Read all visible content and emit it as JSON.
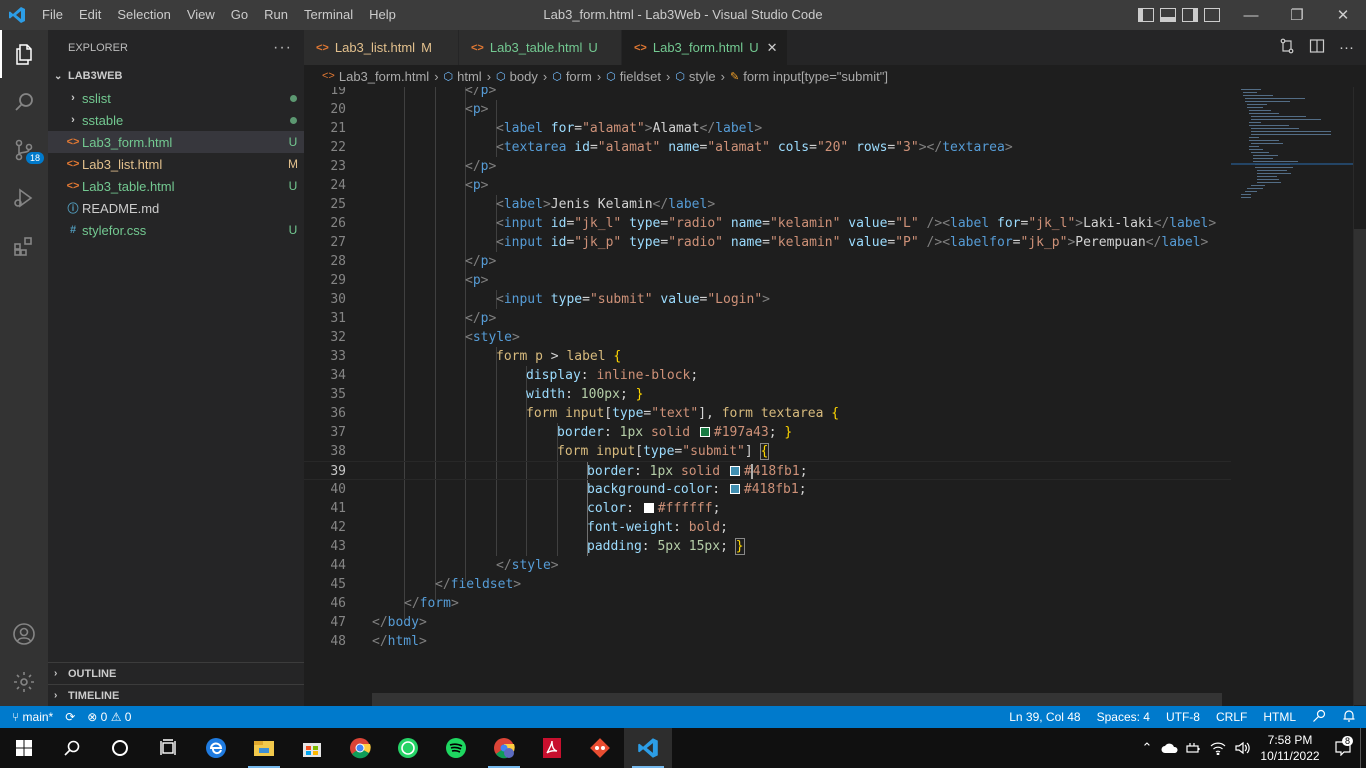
{
  "titlebar": {
    "menu": [
      "File",
      "Edit",
      "Selection",
      "View",
      "Go",
      "Run",
      "Terminal",
      "Help"
    ],
    "title": "Lab3_form.html - Lab3Web - Visual Studio Code",
    "window_controls": [
      "—",
      "❐",
      "✕"
    ]
  },
  "activitybar": {
    "items": [
      "files-icon",
      "search-icon",
      "source-control-icon",
      "run-debug-icon",
      "extensions-icon"
    ],
    "scm_badge": "18",
    "bottom": [
      "account-icon",
      "settings-gear-icon"
    ]
  },
  "sidebar": {
    "header": "EXPLORER",
    "more": "···",
    "folder": "LAB3WEB",
    "items": [
      {
        "icon": "›",
        "name": "sslist",
        "status": "dot",
        "color": "#73c991"
      },
      {
        "icon": "›",
        "name": "sstable",
        "status": "dot",
        "color": "#73c991"
      },
      {
        "icon": "<>",
        "name": "Lab3_form.html",
        "status": "U",
        "color": "#73c991"
      },
      {
        "icon": "<>",
        "name": "Lab3_list.html",
        "status": "M",
        "color": "#e2c08d"
      },
      {
        "icon": "<>",
        "name": "Lab3_table.html",
        "status": "U",
        "color": "#73c991"
      },
      {
        "icon": "ⓘ",
        "name": "README.md",
        "status": "",
        "color": "#cccccc"
      },
      {
        "icon": "#",
        "name": "stylefor.css",
        "status": "U",
        "color": "#73c991"
      }
    ],
    "outline": "OUTLINE",
    "timeline": "TIMELINE"
  },
  "tabs": [
    {
      "label": "Lab3_list.html",
      "status": "M"
    },
    {
      "label": "Lab3_table.html",
      "status": "U"
    },
    {
      "label": "Lab3_form.html",
      "status": "U",
      "close": "✕"
    }
  ],
  "breadcrumb": {
    "items": [
      "Lab3_form.html",
      "html",
      "body",
      "form",
      "fieldset",
      "style",
      "form input[type=\"submit\"]"
    ]
  },
  "editor": {
    "line_numbers": [
      "19",
      "20",
      "21",
      "22",
      "23",
      "24",
      "25",
      "26",
      "27",
      "28",
      "29",
      "30",
      "31",
      "32",
      "33",
      "34",
      "35",
      "36",
      "37",
      "38",
      "39",
      "40",
      "41",
      "42",
      "43",
      "44",
      "45",
      "46",
      "47",
      "48"
    ],
    "current_line": "39",
    "swatches": {
      "green": "#197a43",
      "blue": "#418fb1",
      "white": "#ffffff"
    }
  },
  "statusbar": {
    "branch": "main*",
    "sync": "⟳",
    "problems": "⊗ 0 ⚠ 0",
    "position": "Ln 39, Col 48",
    "spaces": "Spaces: 4",
    "encoding": "UTF-8",
    "eol": "CRLF",
    "language": "HTML"
  },
  "taskbar": {
    "time": "7:58 PM",
    "date": "10/11/2022",
    "notifications": "8"
  }
}
